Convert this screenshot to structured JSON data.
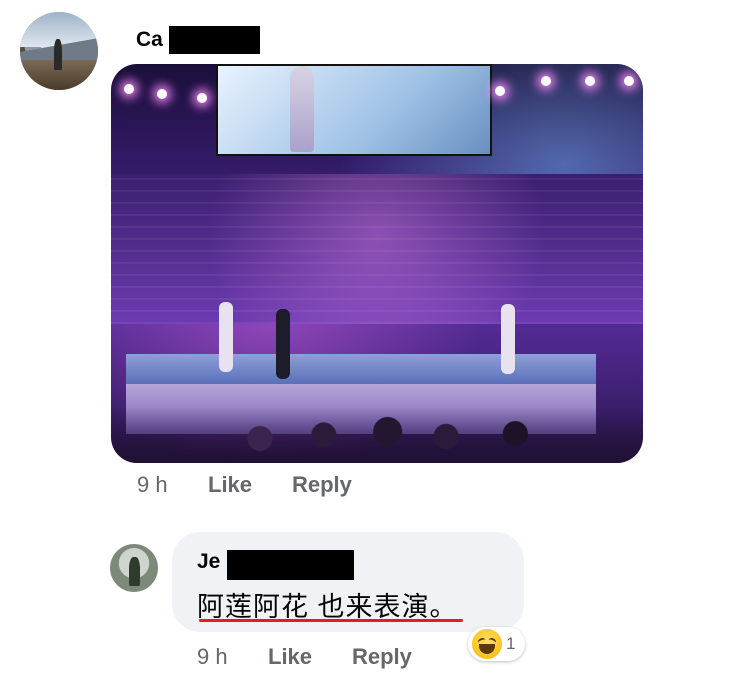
{
  "comment": {
    "author_visible": "Ca",
    "time": "9 h",
    "like_label": "Like",
    "reply_label": "Reply"
  },
  "reply": {
    "author_visible": "Je",
    "text": "阿莲阿花 也来表演。",
    "time": "9 h",
    "like_label": "Like",
    "reply_label": "Reply",
    "reaction_icon": "haha-emoji-icon",
    "reaction_count": "1"
  },
  "colors": {
    "bubble_bg": "#f0f2f5",
    "meta_text": "#65676b",
    "spellcheck_underline": "#e02020"
  }
}
